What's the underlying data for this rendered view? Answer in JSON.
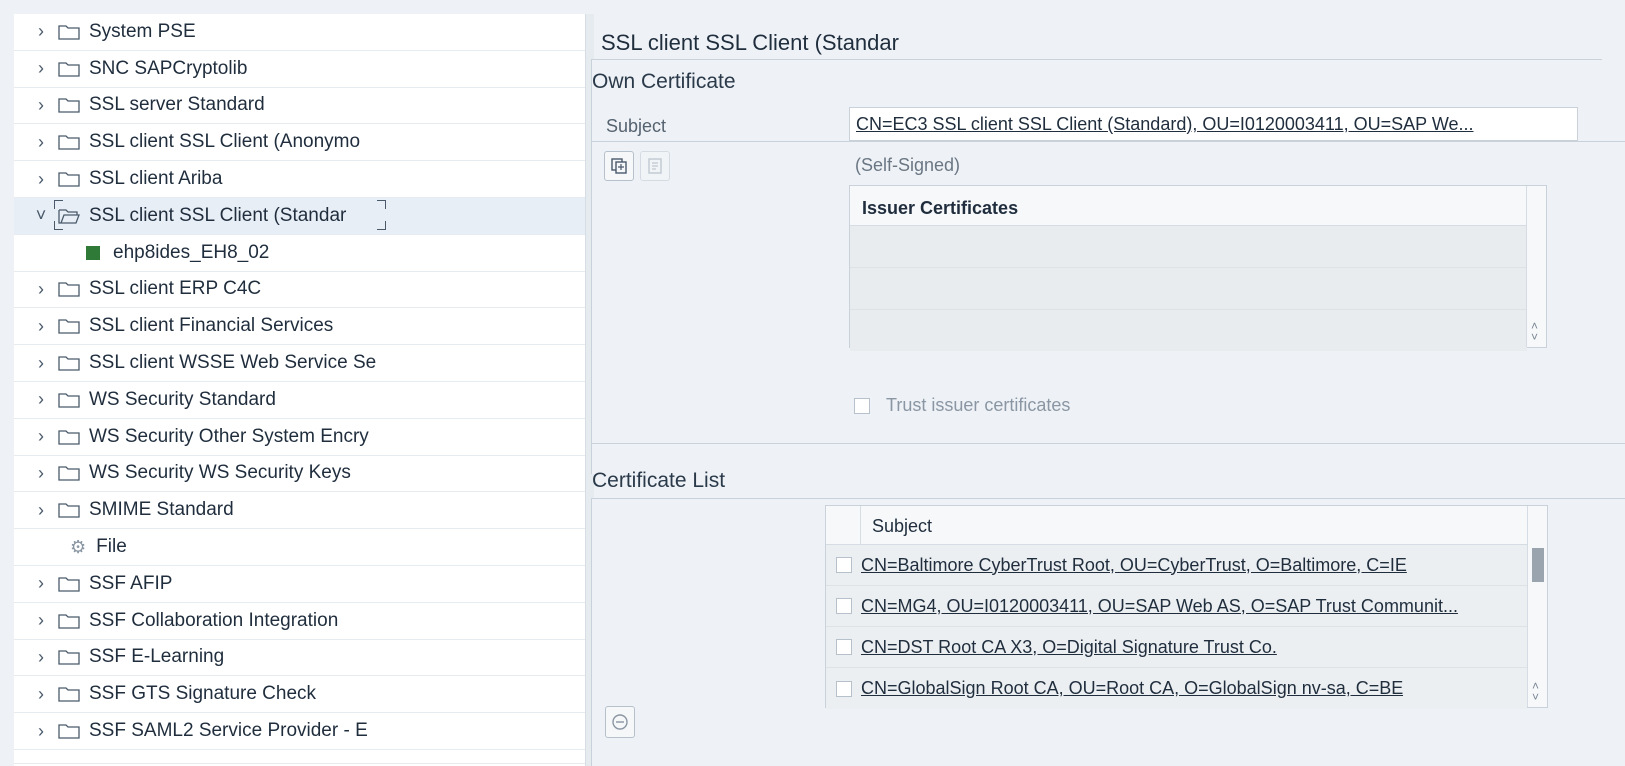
{
  "tree": {
    "items": [
      {
        "label": "System PSE",
        "kind": "folder"
      },
      {
        "label": "SNC SAPCryptolib",
        "kind": "folder"
      },
      {
        "label": "SSL server Standard",
        "kind": "folder"
      },
      {
        "label": "SSL client SSL Client (Anonymo",
        "kind": "folder"
      },
      {
        "label": "SSL client Ariba",
        "kind": "folder"
      },
      {
        "label": "SSL client SSL Client (Standar",
        "kind": "folder",
        "expanded": true,
        "selected": true
      },
      {
        "label": "ehp8ides_EH8_02",
        "kind": "child"
      },
      {
        "label": "SSL client ERP C4C",
        "kind": "folder"
      },
      {
        "label": "SSL client Financial Services",
        "kind": "folder"
      },
      {
        "label": "SSL client WSSE Web Service Se",
        "kind": "folder"
      },
      {
        "label": "WS Security Standard",
        "kind": "folder"
      },
      {
        "label": "WS Security Other System Encry",
        "kind": "folder"
      },
      {
        "label": "WS Security WS Security Keys",
        "kind": "folder"
      },
      {
        "label": "SMIME Standard",
        "kind": "folder"
      },
      {
        "label": "File",
        "kind": "file"
      },
      {
        "label": "SSF AFIP",
        "kind": "folder"
      },
      {
        "label": "SSF Collaboration Integration",
        "kind": "folder"
      },
      {
        "label": "SSF E-Learning",
        "kind": "folder"
      },
      {
        "label": "SSF GTS Signature Check",
        "kind": "folder"
      },
      {
        "label": "SSF SAML2 Service Provider - E",
        "kind": "folder"
      }
    ]
  },
  "detail": {
    "title": "SSL client SSL Client (Standar",
    "own_certificate": {
      "title": "Own Certificate",
      "subject_label": "Subject",
      "subject_value": "CN=EC3 SSL client SSL Client (Standard), OU=I0120003411, OU=SAP We...",
      "self_signed": "(Self-Signed)",
      "issuer_header": "Issuer Certificates",
      "trust_label": "Trust issuer certificates"
    },
    "certificate_list": {
      "title": "Certificate List",
      "header": "Subject",
      "rows": [
        "CN=Baltimore CyberTrust Root, OU=CyberTrust, O=Baltimore, C=IE",
        "CN=MG4, OU=I0120003411, OU=SAP Web AS, O=SAP Trust Communit...",
        "CN=DST Root CA X3, O=Digital Signature Trust Co.",
        "CN=GlobalSign Root CA, OU=Root CA, O=GlobalSign nv-sa, C=BE"
      ]
    }
  },
  "icons": {
    "collapsed": "chevron-right-icon",
    "expanded": "chevron-down-icon",
    "folder": "folder-icon",
    "file": "gear-icon",
    "pse_entry": "certificate-entry-icon"
  },
  "colors": {
    "leaf_green": "#2f7a36",
    "selected_row": "#e8eef6"
  }
}
